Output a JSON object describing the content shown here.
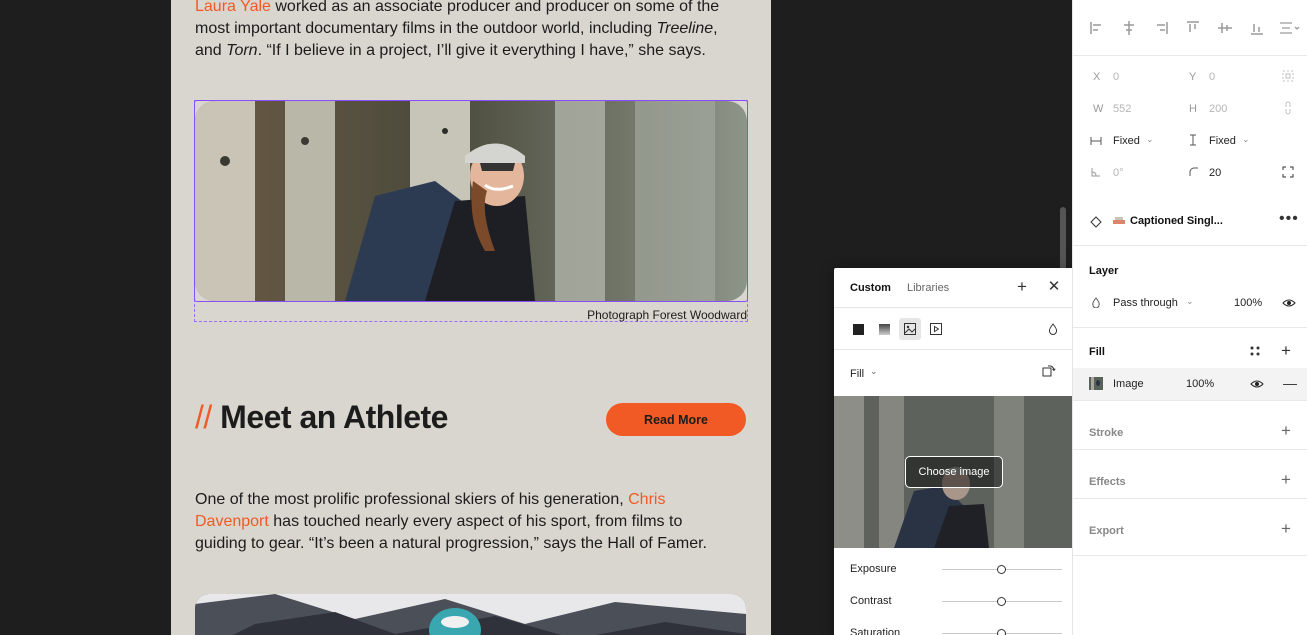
{
  "canvas": {
    "para1": {
      "link": "Laura Yale",
      "t1": " worked as an associate producer and producer on some of the most important documentary films in the outdoor world, including ",
      "em1": "Treeline",
      "t2": ", and ",
      "em2": "Torn",
      "t3": ". “If I believe in a project, I’ll give it everything I have,”  she says."
    },
    "caption": "Photograph Forest Woodward",
    "heading_slashes": "//",
    "heading": "Meet an Athlete",
    "read_more": "Read More",
    "para2": {
      "t1": "One of the most prolific professional skiers of his generation, ",
      "link": "Chris Davenport",
      "t2": " has touched nearly every aspect of his sport, from films to guiding to gear. “It’s been a natural progression,” says the Hall of Famer."
    },
    "accent_color": "#f15a24",
    "selection_color": "#8a4dff"
  },
  "popover": {
    "tabs": [
      "Custom",
      "Libraries"
    ],
    "fill_mode": "Fill",
    "choose_image": "Choose image",
    "adjustments": [
      "Exposure",
      "Contrast",
      "Saturation"
    ]
  },
  "panel": {
    "x_label": "X",
    "x_value": "0",
    "y_label": "Y",
    "y_value": "0",
    "w_label": "W",
    "w_value": "552",
    "h_label": "H",
    "h_value": "200",
    "width_mode": "Fixed",
    "height_mode": "Fixed",
    "rotation": "0°",
    "radius": "20",
    "component_name": "Captioned Singl...",
    "layer_title": "Layer",
    "blend_mode": "Pass through",
    "layer_opacity": "100%",
    "fill_title": "Fill",
    "fill_type": "Image",
    "fill_opacity": "100%",
    "stroke_title": "Stroke",
    "effects_title": "Effects",
    "export_title": "Export"
  }
}
